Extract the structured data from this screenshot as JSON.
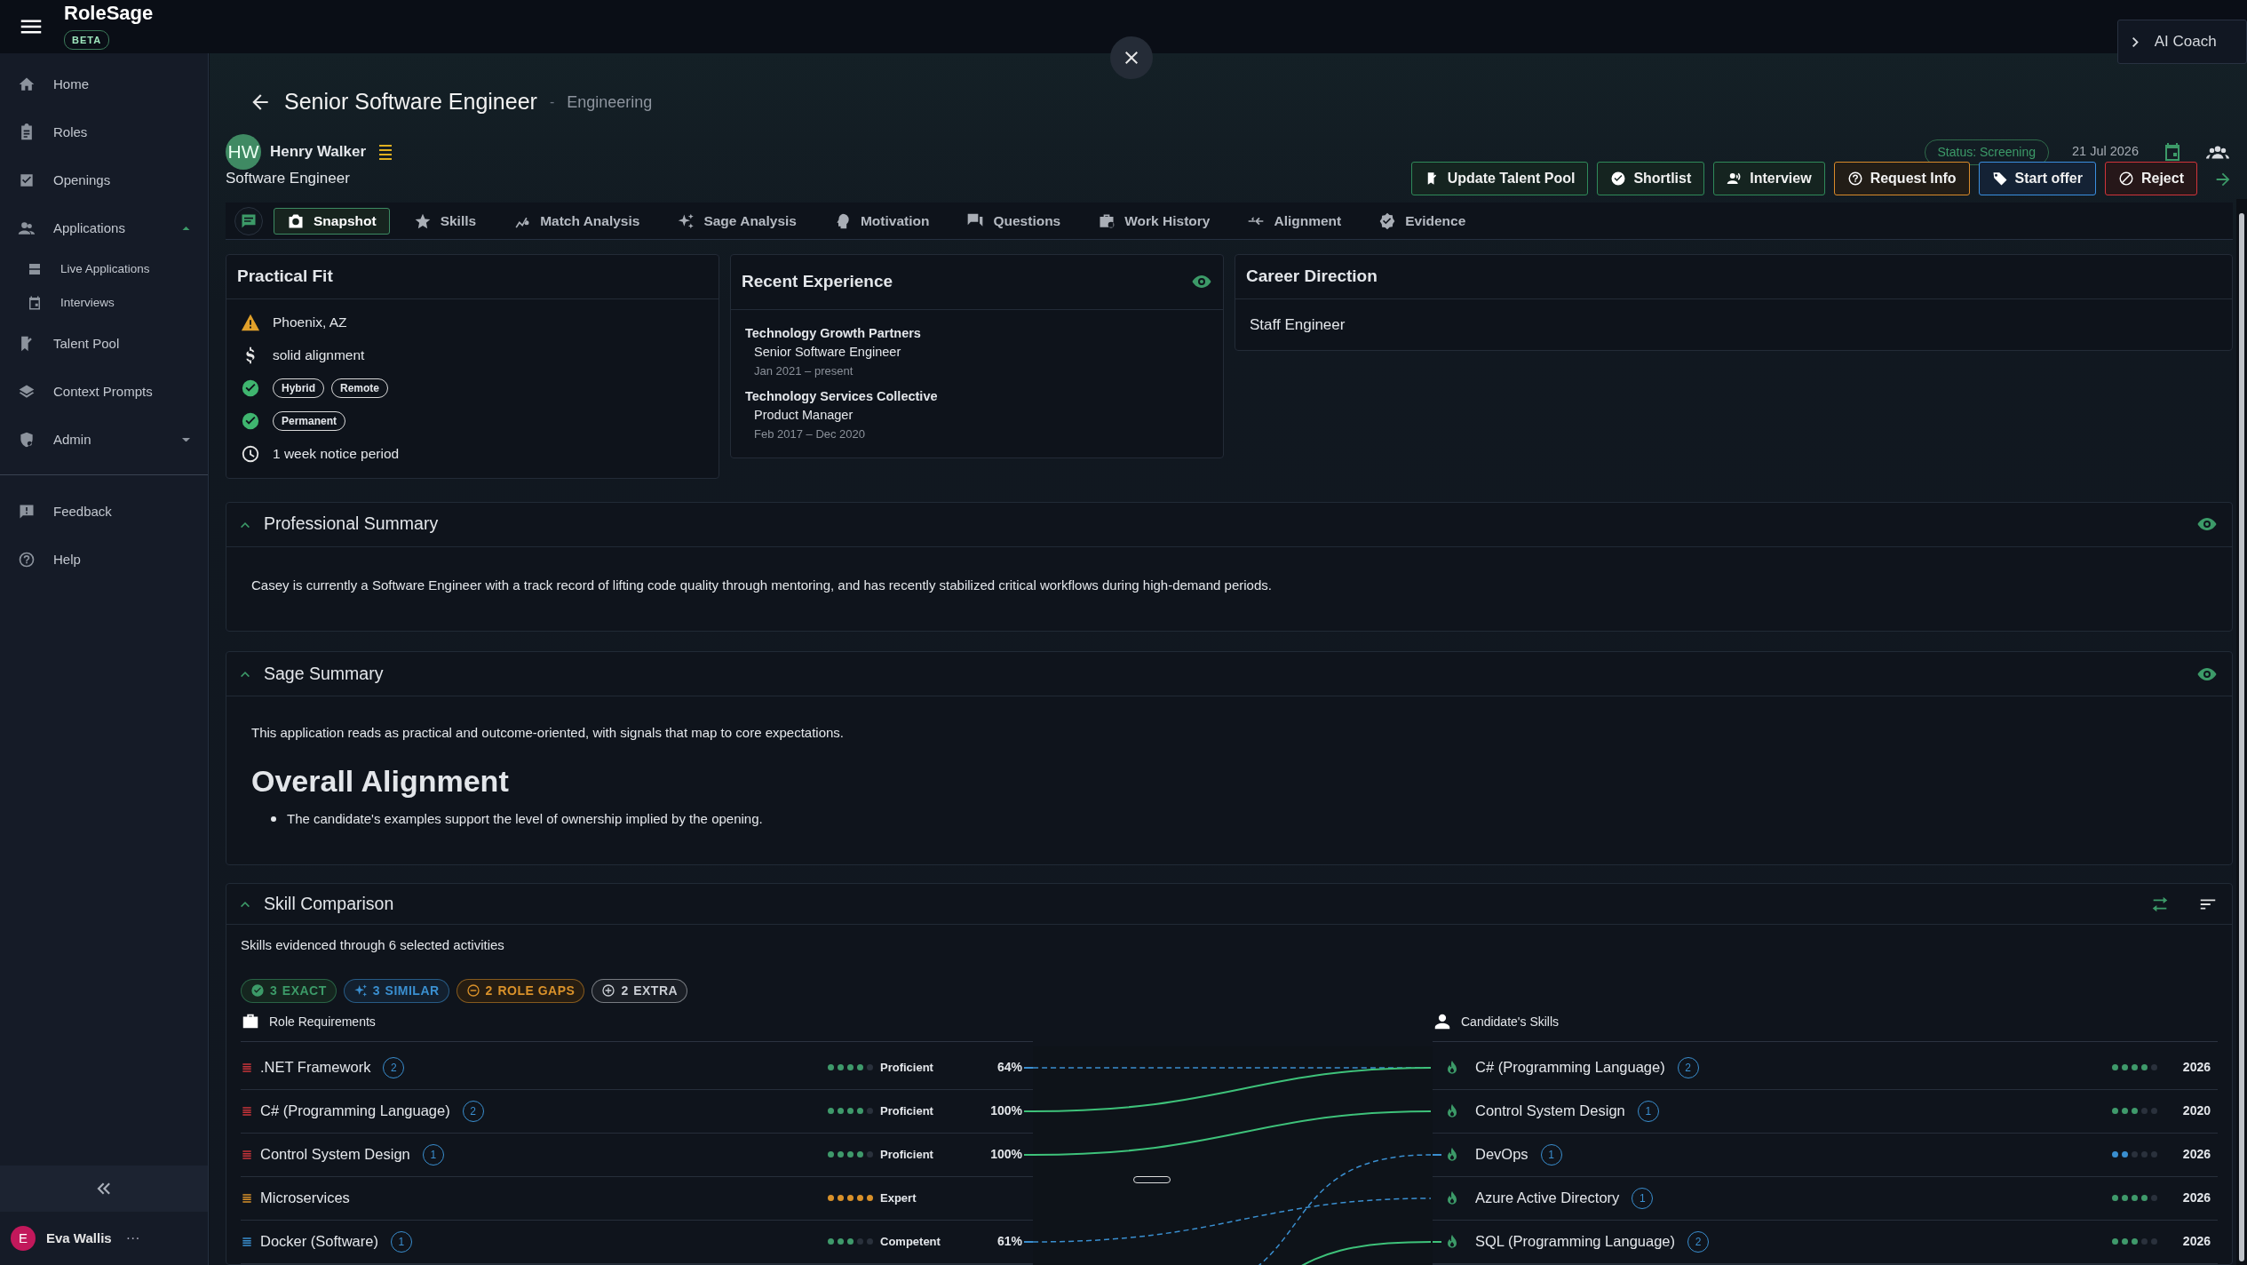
{
  "app": {
    "name": "RoleSage",
    "badge": "BETA",
    "coach_button": "AI Coach"
  },
  "sidebar": {
    "items": [
      {
        "label": "Home",
        "kind": "link"
      },
      {
        "label": "Roles",
        "kind": "link"
      },
      {
        "label": "Openings",
        "kind": "link"
      },
      {
        "label": "Applications",
        "kind": "group",
        "expanded": true,
        "children": [
          {
            "label": "Live Applications"
          },
          {
            "label": "Interviews"
          }
        ]
      },
      {
        "label": "Talent Pool",
        "kind": "link"
      },
      {
        "label": "Context Prompts",
        "kind": "link"
      },
      {
        "label": "Admin",
        "kind": "group",
        "expanded": false
      }
    ],
    "footer_items": [
      {
        "label": "Feedback"
      },
      {
        "label": "Help"
      }
    ],
    "user": {
      "initial": "E",
      "name": "Eva Wallis",
      "more": "···"
    }
  },
  "header": {
    "title": "Senior Software Engineer",
    "separator": "-",
    "department": "Engineering",
    "candidate": {
      "initials": "HW",
      "name": "Henry Walker",
      "current_title": "Software Engineer"
    },
    "status": "Status: Screening",
    "date": "21 Jul 2026",
    "actions": [
      {
        "label": "Update Talent Pool",
        "kind": "success"
      },
      {
        "label": "Shortlist",
        "kind": "success"
      },
      {
        "label": "Interview",
        "kind": "success"
      },
      {
        "label": "Request Info",
        "kind": "warning"
      },
      {
        "label": "Start offer",
        "kind": "info"
      },
      {
        "label": "Reject",
        "kind": "danger"
      }
    ]
  },
  "tabs": [
    {
      "label": "Snapshot",
      "selected": true
    },
    {
      "label": "Skills",
      "selected": false
    },
    {
      "label": "Match Analysis",
      "selected": false
    },
    {
      "label": "Sage Analysis",
      "selected": false
    },
    {
      "label": "Motivation",
      "selected": false
    },
    {
      "label": "Questions",
      "selected": false
    },
    {
      "label": "Work History",
      "selected": false
    },
    {
      "label": "Alignment",
      "selected": false
    },
    {
      "label": "Evidence",
      "selected": false
    }
  ],
  "practical_fit": {
    "title": "Practical Fit",
    "items": [
      {
        "kind": "warning",
        "text": "Phoenix, AZ"
      },
      {
        "kind": "salary",
        "text": "solid alignment"
      },
      {
        "kind": "check",
        "tags": [
          "Hybrid",
          "Remote"
        ]
      },
      {
        "kind": "check",
        "tags": [
          "Permanent"
        ]
      },
      {
        "kind": "clock",
        "text": "1 week notice period"
      }
    ]
  },
  "recent_experience": {
    "title": "Recent Experience",
    "jobs": [
      {
        "company": "Technology Growth Partners",
        "role": "Senior Software Engineer",
        "dates": "Jan 2021 – present"
      },
      {
        "company": "Technology Services Collective",
        "role": "Product Manager",
        "dates": "Feb 2017 – Dec 2020"
      }
    ]
  },
  "career_direction": {
    "title": "Career Direction",
    "text": "Staff Engineer"
  },
  "professional_summary": {
    "title": "Professional Summary",
    "expanded": true,
    "text": "Casey is currently a Software Engineer with a track record of lifting code quality through mentoring, and has recently stabilized critical workflows during high-demand periods."
  },
  "sage_summary": {
    "title": "Sage Summary",
    "expanded": true,
    "text": "This application reads as practical and outcome-oriented, with signals that map to core expectations.",
    "heading": "Overall Alignment",
    "bullets": [
      "The candidate's examples support the level of ownership implied by the opening."
    ]
  },
  "skill_comparison": {
    "title": "Skill Comparison",
    "expanded": true,
    "subtitle": "Skills evidenced through 6 selected activities",
    "chips": [
      {
        "kind": "exact",
        "count": "3",
        "label": "EXACT"
      },
      {
        "kind": "similar",
        "count": "3",
        "label": "SIMILAR"
      },
      {
        "kind": "gap",
        "count": "2",
        "label": "ROLE GAPS"
      },
      {
        "kind": "extra",
        "count": "2",
        "label": "EXTRA"
      }
    ],
    "left_heading": "Role Requirements",
    "right_heading": "Candidate's Skills",
    "requirements": [
      {
        "kind": "essential",
        "matched": true,
        "exact": false,
        "name": ".NET Framework",
        "count": "2",
        "stars": 4,
        "color": "#3f9a6b",
        "level_label": "Proficient",
        "match": "64%"
      },
      {
        "kind": "essential",
        "matched": true,
        "exact": true,
        "name": "C# (Programming Language)",
        "count": "2",
        "stars": 4,
        "color": "#3f9a6b",
        "level_label": "Proficient",
        "match": "100%"
      },
      {
        "kind": "essential",
        "matched": true,
        "exact": true,
        "name": "Control System Design",
        "count": "1",
        "stars": 4,
        "color": "#3f9a6b",
        "level_label": "Proficient",
        "match": "100%"
      },
      {
        "kind": "important",
        "matched": false,
        "name": "Microservices",
        "stars": 5,
        "color": "#d9912a",
        "level_label": "Expert"
      },
      {
        "kind": "desirable",
        "matched": true,
        "exact": false,
        "name": "Docker (Software)",
        "count": "1",
        "stars": 3,
        "color": "#3f9a6b",
        "level_label": "Competent",
        "match": "61%"
      }
    ],
    "candidate_skills": [
      {
        "name": "C# (Programming Language)",
        "count": "2",
        "stars": 4,
        "color": "#3f9a6b",
        "year": "2026",
        "linked_from_below": false
      },
      {
        "name": "Control System Design",
        "count": "1",
        "stars": 3,
        "color": "#3f9a6b",
        "year": "2020",
        "linked_from_below": false
      },
      {
        "name": "DevOps",
        "count": "1",
        "stars": 2,
        "color": "#3a8fd0",
        "year": "2026",
        "linked_from_below": true,
        "exact": false
      },
      {
        "name": "Azure Active Directory",
        "count": "1",
        "stars": 4,
        "color": "#3f9a6b",
        "year": "2026",
        "linked_from_below": false
      },
      {
        "name": "SQL (Programming Language)",
        "count": "2",
        "stars": 3,
        "color": "#3f9a6b",
        "year": "2026",
        "linked_from_below": true,
        "exact": true
      }
    ]
  }
}
